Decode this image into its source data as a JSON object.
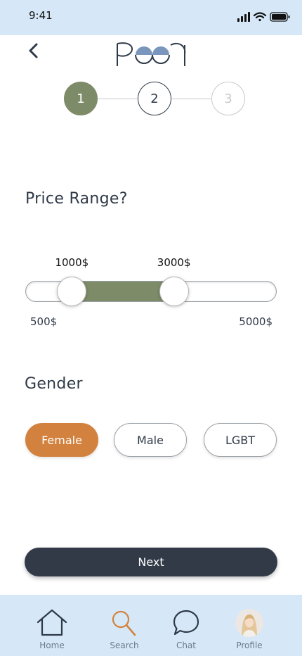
{
  "status_bar": {
    "time": "9:41"
  },
  "header": {
    "logo_alt": "Peer"
  },
  "steps": [
    {
      "label": "1",
      "state": "active"
    },
    {
      "label": "2",
      "state": "next"
    },
    {
      "label": "3",
      "state": "disabled"
    }
  ],
  "price": {
    "title": "Price Range?",
    "min_label": "500$",
    "max_label": "5000$",
    "low_value": "1000$",
    "high_value": "3000$",
    "min": 500,
    "max": 5000,
    "low": 1000,
    "high": 3000
  },
  "gender": {
    "title": "Gender",
    "options": [
      "Female",
      "Male",
      "LGBT"
    ],
    "selected": "Female"
  },
  "next_label": "Next",
  "tabs": [
    {
      "label": "Home",
      "icon": "home-icon"
    },
    {
      "label": "Search",
      "icon": "search-icon",
      "active": true
    },
    {
      "label": "Chat",
      "icon": "chat-icon"
    },
    {
      "label": "Profile",
      "icon": "avatar"
    }
  ],
  "colors": {
    "status_bg": "#d6e8f7",
    "primary_green": "#7e8b68",
    "accent_orange": "#d2823e",
    "dark_button": "#323a48",
    "text_dark": "#2f3a48"
  }
}
